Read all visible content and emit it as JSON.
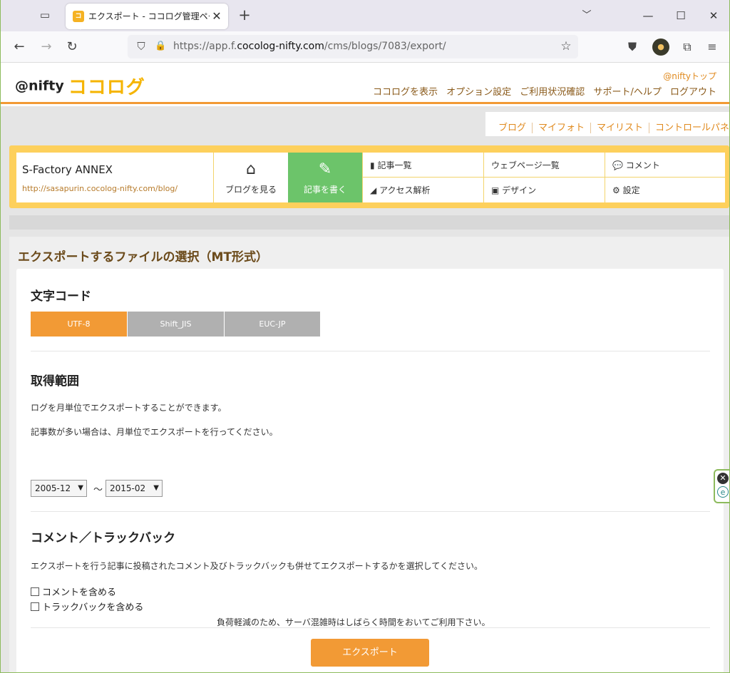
{
  "browser": {
    "tab_title": "エクスポート - ココログ管理ページ:@",
    "favicon_text": "ココ",
    "url_prefix": "https://app.f.",
    "url_domain": "cocolog-nifty.com",
    "url_path": "/cms/blogs/7083/export/",
    "new_tab_glyph": "+",
    "tab_close_glyph": "✕"
  },
  "site_header": {
    "logo_nifty": "@nifty",
    "logo_cocolog": "ココログ",
    "nifty_top": "@niftyトップ",
    "links": [
      "ココログを表示",
      "オプション設定",
      "ご利用状況確認",
      "サポート/ヘルプ",
      "ログアウト"
    ]
  },
  "top_tabs": [
    "ブログ",
    "マイフォト",
    "マイリスト",
    "コントロールパネル"
  ],
  "blog_panel": {
    "name": "S-Factory ANNEX",
    "url": "http://sasapurin.cocolog-nifty.com/blog/",
    "view_label": "ブログを見る",
    "write_label": "記事を書く",
    "menu": {
      "articles": "記事一覧",
      "webpages": "ウェブページ一覧",
      "comments": "コメント",
      "access": "アクセス解析",
      "design": "デザイン",
      "settings": "設定"
    }
  },
  "page": {
    "title": "エクスポートするファイルの選択（MT形式）",
    "charset": {
      "heading": "文字コード",
      "options": [
        "UTF-8",
        "Shift_JIS",
        "EUC-JP"
      ],
      "selected": "UTF-8"
    },
    "range": {
      "heading": "取得範囲",
      "desc1": "ログを月単位でエクスポートすることができます。",
      "desc2": "記事数が多い場合は、月単位でエクスポートを行ってください。",
      "from": "2005-12",
      "separator": "～",
      "to": "2015-02"
    },
    "comments": {
      "heading": "コメント／トラックバック",
      "desc": "エクスポートを行う記事に投稿されたコメント及びトラックバックも併せてエクスポートするかを選択してください。",
      "include_comments": "コメントを含める",
      "include_trackbacks": "トラックバックを含める"
    },
    "notice": "負荷軽減のため、サーバ混雑時はしばらく時間をおいてご利用下さい。",
    "export_button": "エクスポート"
  },
  "colors": {
    "accent": "#f29a35",
    "panel": "#fdd05c",
    "write": "#6cc46a",
    "logo": "#f5b400"
  }
}
